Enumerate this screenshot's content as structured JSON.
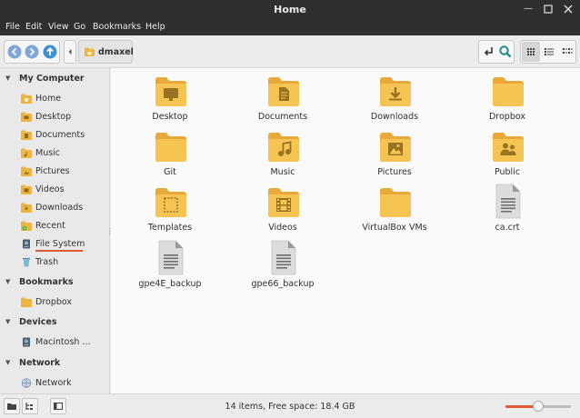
{
  "window": {
    "title": "Home"
  },
  "menubar": [
    "File",
    "Edit",
    "View",
    "Go",
    "Bookmarks",
    "Help"
  ],
  "toolbar": {
    "path_label": "dmaxel"
  },
  "sidebar": {
    "sections": [
      {
        "title": "My Computer",
        "items": [
          {
            "label": "Home",
            "icon": "home-folder-icon"
          },
          {
            "label": "Desktop",
            "icon": "desktop-folder-icon"
          },
          {
            "label": "Documents",
            "icon": "documents-folder-icon"
          },
          {
            "label": "Music",
            "icon": "music-folder-icon"
          },
          {
            "label": "Pictures",
            "icon": "pictures-folder-icon"
          },
          {
            "label": "Videos",
            "icon": "videos-folder-icon"
          },
          {
            "label": "Downloads",
            "icon": "downloads-folder-icon"
          },
          {
            "label": "Recent",
            "icon": "recent-folder-icon"
          },
          {
            "label": "File System",
            "icon": "drive-icon"
          },
          {
            "label": "Trash",
            "icon": "trash-icon"
          }
        ]
      },
      {
        "title": "Bookmarks",
        "items": [
          {
            "label": "Dropbox",
            "icon": "folder-icon"
          }
        ]
      },
      {
        "title": "Devices",
        "items": [
          {
            "label": "Macintosh ...",
            "icon": "drive-icon"
          }
        ]
      },
      {
        "title": "Network",
        "items": [
          {
            "label": "Network",
            "icon": "network-icon"
          }
        ]
      }
    ]
  },
  "files": [
    {
      "name": "Desktop",
      "type": "folder",
      "emblem": "desktop"
    },
    {
      "name": "Documents",
      "type": "folder",
      "emblem": "document"
    },
    {
      "name": "Downloads",
      "type": "folder",
      "emblem": "download"
    },
    {
      "name": "Dropbox",
      "type": "folder",
      "emblem": ""
    },
    {
      "name": "Git",
      "type": "folder",
      "emblem": ""
    },
    {
      "name": "Music",
      "type": "folder",
      "emblem": "music"
    },
    {
      "name": "Pictures",
      "type": "folder",
      "emblem": "picture"
    },
    {
      "name": "Public",
      "type": "folder",
      "emblem": "people"
    },
    {
      "name": "Templates",
      "type": "folder",
      "emblem": "template"
    },
    {
      "name": "Videos",
      "type": "folder",
      "emblem": "video"
    },
    {
      "name": "VirtualBox VMs",
      "type": "folder",
      "emblem": ""
    },
    {
      "name": "ca.crt",
      "type": "file",
      "emblem": ""
    },
    {
      "name": "gpe4E_backup",
      "type": "file",
      "emblem": ""
    },
    {
      "name": "gpe66_backup",
      "type": "file",
      "emblem": ""
    }
  ],
  "status": {
    "text": "14 items, Free space: 18.4 GB",
    "zoom_level": 0.5
  },
  "colors": {
    "folder": "#f6c453",
    "folder_dark": "#e9a93a",
    "accent": "#e05a36",
    "nav_blue": "#3d8fd6"
  }
}
